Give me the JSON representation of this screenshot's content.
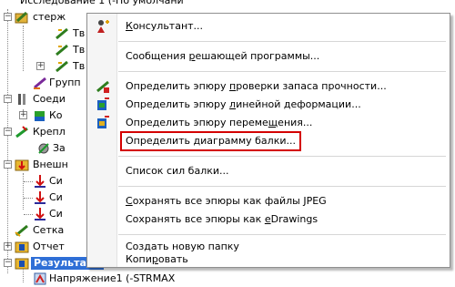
{
  "tree": {
    "root": "Исследование 1 (-По умолчани",
    "items": [
      {
        "label": "стерж"
      },
      {
        "label": "Тв"
      },
      {
        "label": "Тв"
      },
      {
        "label": "Тв"
      },
      {
        "label": "Групп"
      },
      {
        "label": "Соеди"
      },
      {
        "label": "Ко"
      },
      {
        "label": "Крепл"
      },
      {
        "label": "За"
      },
      {
        "label": "Внешн"
      },
      {
        "label": "Си"
      },
      {
        "label": "Си"
      },
      {
        "label": "Си"
      },
      {
        "label": "Сетка"
      },
      {
        "label": "Отчет"
      },
      {
        "label": "Результаты"
      },
      {
        "label": "Напряжение1 (-STRMAX"
      }
    ]
  },
  "menu": {
    "items": [
      {
        "pre": "",
        "key": "К",
        "post": "онсультант...",
        "icon": "consultant-icon"
      },
      {
        "pre": "Сообщения ",
        "key": "р",
        "post": "ешающей программы...",
        "icon": ""
      },
      {
        "pre": "Определить эпюру ",
        "key": "п",
        "post": "роверки запаса прочности...",
        "icon": "safety-plot-icon"
      },
      {
        "pre": "Определить эпюру ",
        "key": "л",
        "post": "инейной деформации...",
        "icon": "strain-plot-icon"
      },
      {
        "pre": "Определить эпюру переме",
        "key": "щ",
        "post": "ения...",
        "icon": "displacement-plot-icon"
      },
      {
        "pre": "Определить диаграмму балки...",
        "key": "",
        "post": "",
        "icon": ""
      },
      {
        "pre": "Список сил балки...",
        "key": "",
        "post": "",
        "icon": ""
      },
      {
        "pre": "",
        "key": "С",
        "post": "охранять все эпюры как файлы JPEG",
        "icon": ""
      },
      {
        "pre": "Сохранять все эпюры как ",
        "key": "e",
        "post": "Drawings",
        "icon": ""
      },
      {
        "pre": "Создать новую папку",
        "key": "",
        "post": "",
        "icon": ""
      },
      {
        "pre": "Копи",
        "key": "р",
        "post": "овать",
        "icon": ""
      }
    ]
  },
  "colors": {
    "highlight_box": "#d40000",
    "selection": "#2f6fd6"
  }
}
